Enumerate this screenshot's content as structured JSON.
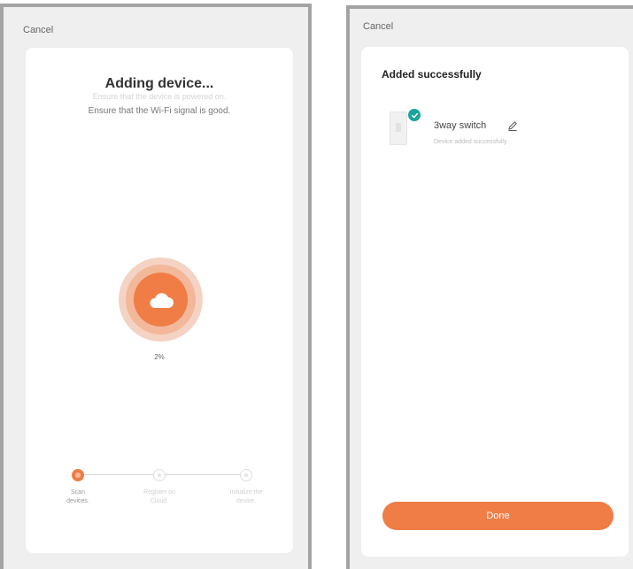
{
  "left_screen": {
    "cancel_label": "Cancel",
    "title": "Adding device...",
    "hint_faded": "Ensure that the device is powered on.",
    "hint_main": "Ensure that the Wi-Fi signal is good.",
    "progress_text": "2%",
    "progress_value": 0.02,
    "icon": "cloud-icon",
    "steps": [
      {
        "label_line1": "Scan",
        "label_line2": "devices.",
        "state": "active"
      },
      {
        "label_line1": "Register on",
        "label_line2": "Cloud.",
        "state": "pending"
      },
      {
        "label_line1": "Initialize the",
        "label_line2": "device.",
        "state": "pending"
      }
    ]
  },
  "right_screen": {
    "cancel_label": "Cancel",
    "title": "Added successfully",
    "device": {
      "name": "3way switch",
      "status": "Device added successfully",
      "icons": [
        "check-badge-icon",
        "pencil-icon"
      ]
    },
    "done_label": "Done"
  },
  "colors": {
    "accent": "#ef7d45",
    "success": "#1ba39c",
    "frame": "#a4a4a4",
    "background": "#efefef"
  }
}
